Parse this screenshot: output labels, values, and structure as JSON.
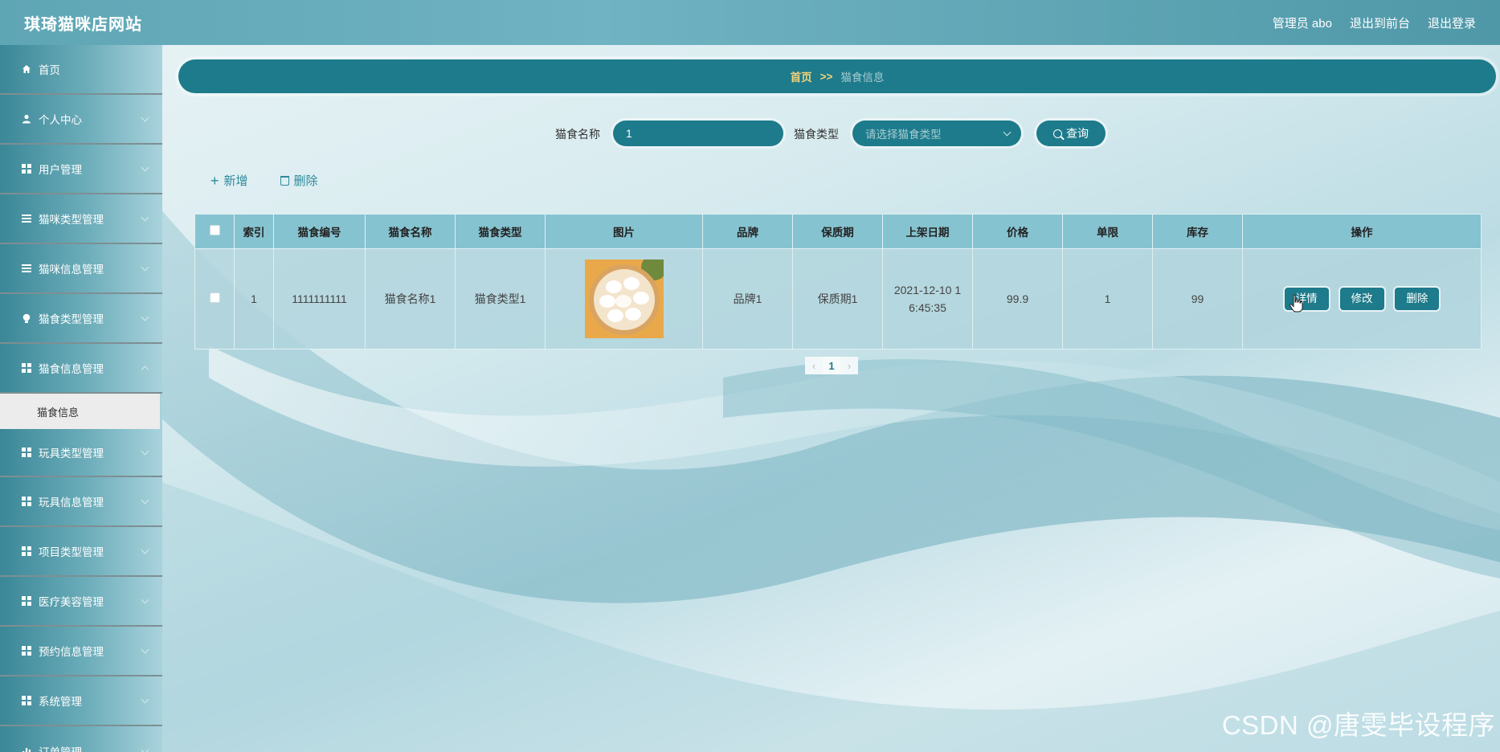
{
  "header": {
    "site_title": "琪琦猫咪店网站",
    "admin_label": "管理员 abo",
    "back_front_label": "退出到前台",
    "logout_label": "退出登录"
  },
  "sidebar": {
    "items": [
      {
        "label": "首页",
        "icon": "home-icon"
      },
      {
        "label": "个人中心",
        "icon": "user-icon"
      },
      {
        "label": "用户管理",
        "icon": "grid-icon"
      },
      {
        "label": "猫咪类型管理",
        "icon": "list-icon"
      },
      {
        "label": "猫咪信息管理",
        "icon": "list-icon"
      },
      {
        "label": "猫食类型管理",
        "icon": "bulb-icon"
      },
      {
        "label": "猫食信息管理",
        "icon": "grid-icon"
      },
      {
        "label": "玩具类型管理",
        "icon": "grid-icon"
      },
      {
        "label": "玩具信息管理",
        "icon": "grid-icon"
      },
      {
        "label": "项目类型管理",
        "icon": "grid-icon"
      },
      {
        "label": "医疗美容管理",
        "icon": "grid-icon"
      },
      {
        "label": "预约信息管理",
        "icon": "grid-icon"
      },
      {
        "label": "系统管理",
        "icon": "grid-icon"
      },
      {
        "label": "订单管理",
        "icon": "chart-icon"
      }
    ],
    "active_sub": "猫食信息"
  },
  "breadcrumb": {
    "home": "首页",
    "separator": ">>",
    "current": "猫食信息"
  },
  "search": {
    "name_label": "猫食名称",
    "name_value": "1",
    "type_label": "猫食类型",
    "type_placeholder": "请选择猫食类型",
    "query_label": "查询"
  },
  "toolbar": {
    "add_label": "新增",
    "delete_label": "删除"
  },
  "table": {
    "columns": [
      "索引",
      "猫食编号",
      "猫食名称",
      "猫食类型",
      "图片",
      "品牌",
      "保质期",
      "上架日期",
      "价格",
      "单限",
      "库存",
      "操作"
    ],
    "rows": [
      {
        "index": "1",
        "code": "1111111111",
        "name": "猫食名称1",
        "type": "猫食类型1",
        "brand": "品牌1",
        "shelf_life": "保质期1",
        "date_line1": "2021-12-10 1",
        "date_line2": "6:45:35",
        "price": "99.9",
        "limit": "1",
        "stock": "99",
        "detail_label": "详情",
        "edit_label": "修改",
        "delete_label": "删除"
      }
    ]
  },
  "pagination": {
    "prev": "‹",
    "current": "1",
    "next": "›"
  },
  "watermark": "CSDN @唐雯毕设程序",
  "colors": {
    "primary": "#1d7b8b",
    "header_bg": "#5fa6b5",
    "table_head": "#86c3d0",
    "breadcrumb_home": "#f4d27a"
  }
}
